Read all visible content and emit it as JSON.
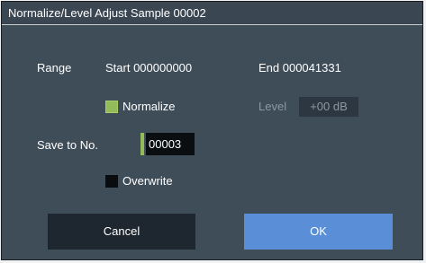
{
  "dialog": {
    "title": "Normalize/Level Adjust Sample 00002"
  },
  "range": {
    "label": "Range",
    "start": "Start 000000000",
    "end": "End 000041331"
  },
  "normalize": {
    "label": "Normalize",
    "checked": true
  },
  "level": {
    "label": "Level",
    "value": "+00 dB",
    "enabled": false
  },
  "save_to": {
    "label": "Save to No.",
    "value": "00003"
  },
  "overwrite": {
    "label": "Overwrite",
    "checked": false
  },
  "buttons": {
    "cancel": "Cancel",
    "ok": "OK"
  },
  "colors": {
    "dialog_bg": "#3f4d59",
    "checkbox_on": "#93bb57",
    "ok_button": "#5a8fd8",
    "cancel_button": "#1e2730"
  }
}
